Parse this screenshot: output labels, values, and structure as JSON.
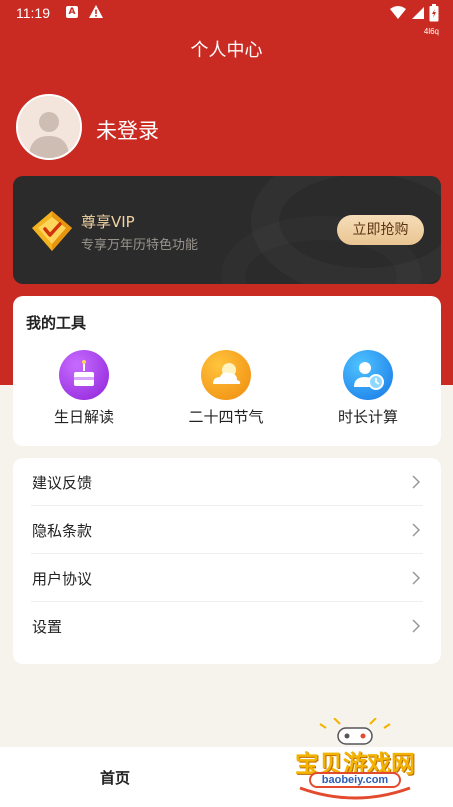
{
  "status_bar": {
    "time": "11:19",
    "notification_letter": "A",
    "network_label": "4l6q"
  },
  "header": {
    "title": "个人中心"
  },
  "user": {
    "name": "未登录",
    "avatar_icon": "person-avatar-icon"
  },
  "vip": {
    "title": "尊享VIP",
    "subtitle": "专享万年历特色功能",
    "button_label": "立即抢购",
    "badge_icon": "vip-diamond-icon"
  },
  "tools": {
    "title": "我的工具",
    "items": [
      {
        "label": "生日解读",
        "icon": "birthday-cake-icon",
        "color": "#a53bea"
      },
      {
        "label": "二十四节气",
        "icon": "weather-sun-cloud-icon",
        "color": "#f7a31d"
      },
      {
        "label": "时长计算",
        "icon": "person-clock-icon",
        "color": "#2f8ff0"
      }
    ]
  },
  "menu": {
    "items": [
      {
        "label": "建议反馈"
      },
      {
        "label": "隐私条款"
      },
      {
        "label": "用户协议"
      },
      {
        "label": "设置"
      }
    ]
  },
  "bottom_nav": {
    "home_label": "首页"
  },
  "watermark": {
    "text": "宝贝游戏网",
    "url": "baobeiy.com"
  },
  "colors": {
    "header_red": "#c92b22",
    "vip_dark": "#2b2b2b",
    "vip_gold": "#f1d2a3",
    "page_bg": "#f6f2ec"
  }
}
